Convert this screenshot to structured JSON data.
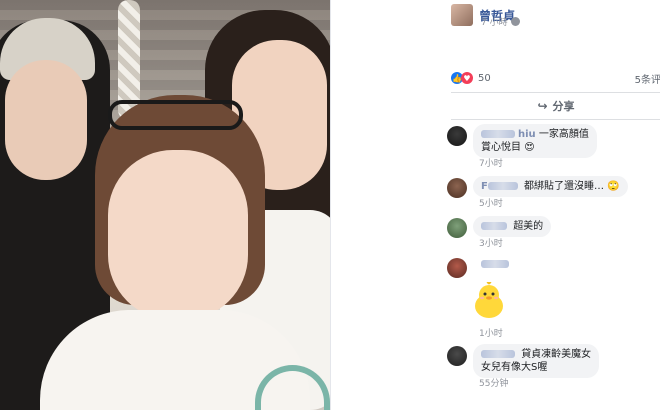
{
  "post": {
    "author_name": "曾哲貞",
    "time": "7 小時",
    "reaction_count": "50",
    "comment_count": "5条评",
    "share_label": "分享"
  },
  "comments": [
    {
      "name_visible": "hiu",
      "text_line1": "一家高顏值",
      "text_line2": "賞心悅目",
      "emoji": "😍",
      "time": "7小时"
    },
    {
      "name_visible": "F",
      "text_line1": "都綁貼了還沒睡…",
      "emoji": "🙄",
      "time": "5小时"
    },
    {
      "name_visible": "",
      "text_line1": "超美的",
      "time": "3小时"
    },
    {
      "name_visible": "",
      "text_line1": "",
      "time": "1小时",
      "sticker": "duck-sticker"
    },
    {
      "name_visible": "",
      "text_line1": "貸貞凍齡美魔女",
      "text_line2": "女兒有像大S喔",
      "time": "55分钟"
    }
  ],
  "colors": {
    "link_blue": "#385898",
    "like_blue": "#1877f2",
    "love_red": "#f33e58",
    "meta_gray": "#90949c",
    "bubble_bg": "#f2f3f5"
  },
  "icons": [
    "globe-icon",
    "like-icon",
    "love-icon",
    "share-icon",
    "duck-sticker-icon"
  ]
}
